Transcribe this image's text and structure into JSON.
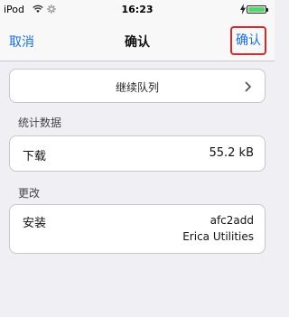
{
  "status_bar": {
    "carrier": "iPod",
    "time": "16:23",
    "battery_color": "#4cd964"
  },
  "nav": {
    "left_label": "取消",
    "title": "确认",
    "right_label": "确认",
    "accent_color": "#1a6ee8",
    "highlight_color": "#d62a2a"
  },
  "queue": {
    "label": "继续队列",
    "icon": "chevron-right-icon"
  },
  "stats": {
    "header": "统计数据",
    "rows": [
      {
        "key": "下载",
        "value": "55.2 kB"
      }
    ]
  },
  "changes": {
    "header": "更改",
    "rows": [
      {
        "key": "安装",
        "values": [
          "afc2add",
          "Erica Utilities"
        ]
      }
    ]
  }
}
